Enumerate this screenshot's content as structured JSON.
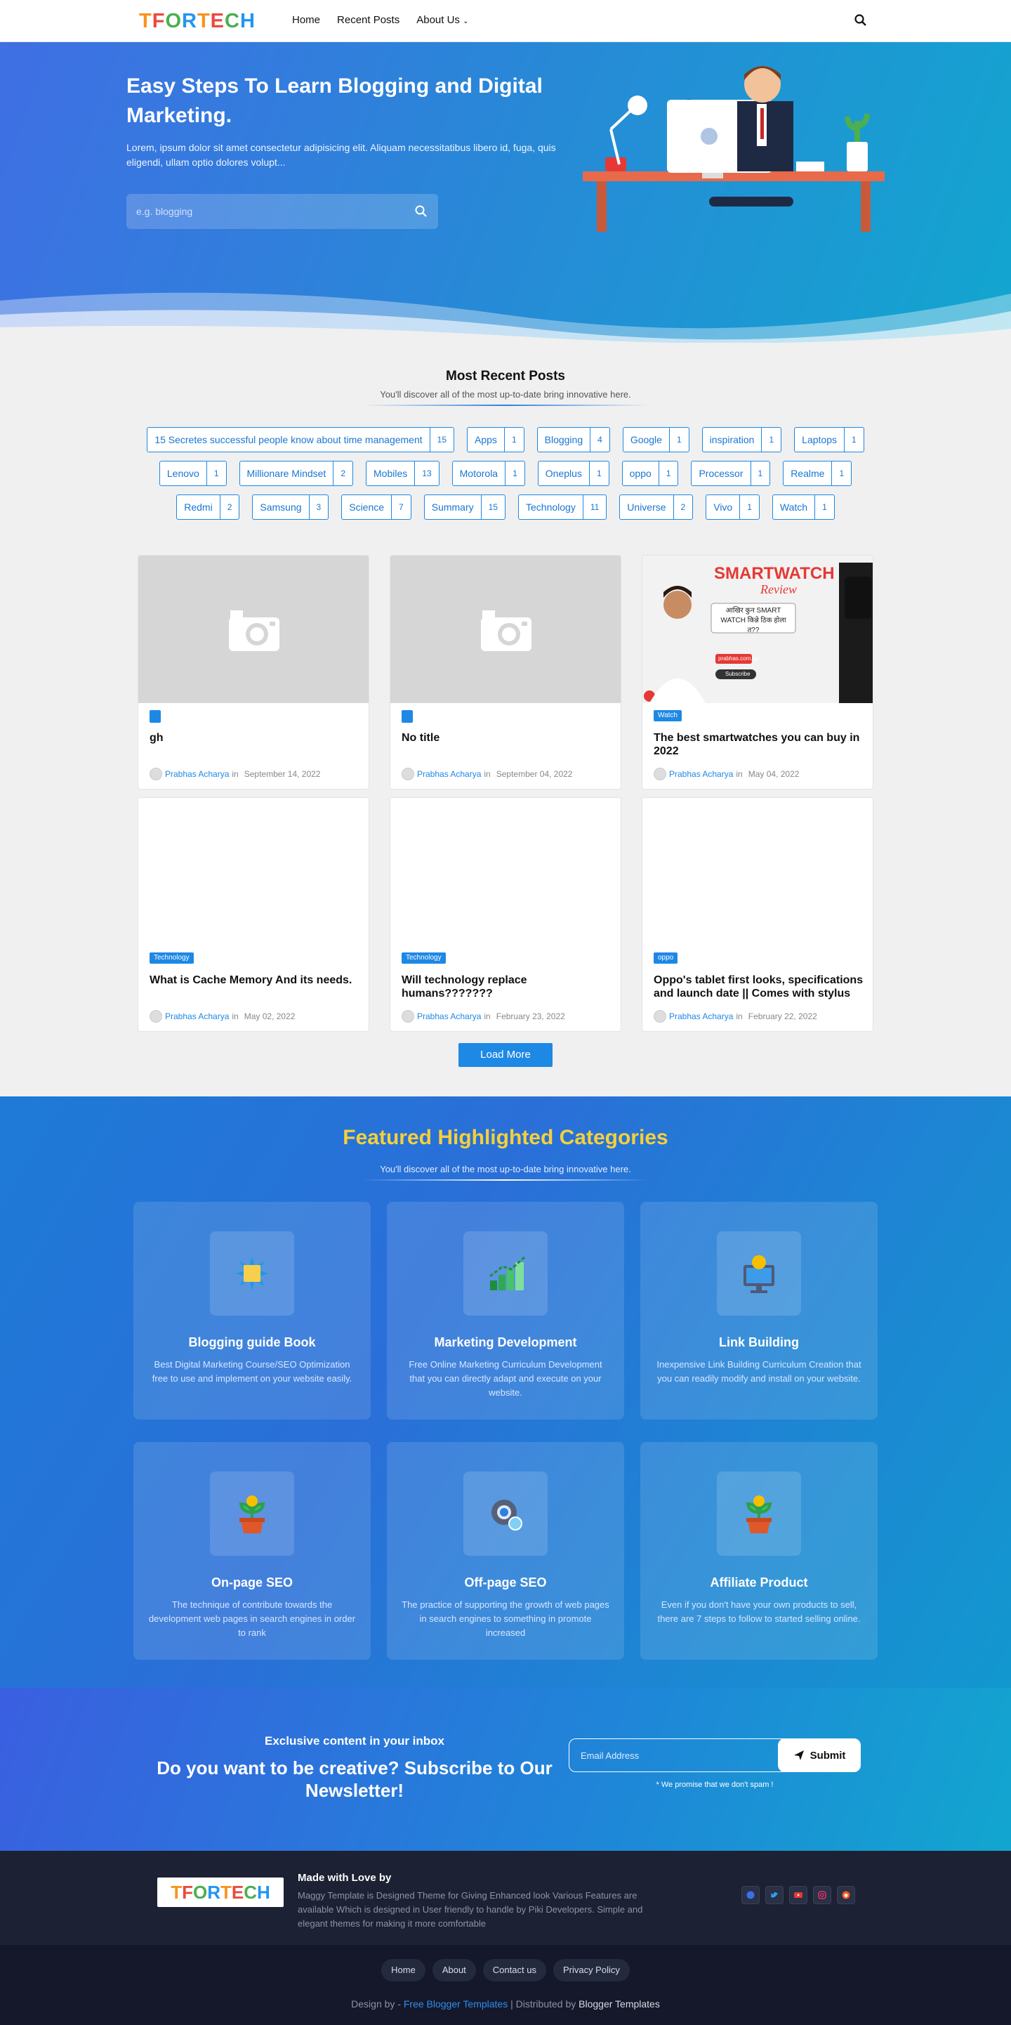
{
  "header": {
    "logo_text": "TFORTECH",
    "nav": [
      "Home",
      "Recent Posts",
      "About Us"
    ]
  },
  "hero": {
    "title": "Easy Steps To Learn Blogging and Digital Marketing.",
    "text": "Lorem, ipsum dolor sit amet consectetur adipisicing elit. Aliquam necessitatibus libero id, fuga, quis eligendi, ullam optio dolores volupt...",
    "search_placeholder": "e.g. blogging"
  },
  "recent": {
    "title": "Most Recent Posts",
    "subtitle": "You'll discover all of the most up-to-date bring innovative here.",
    "tags": [
      {
        "name": "15 Secretes successful people know about time management",
        "count": "15"
      },
      {
        "name": "Apps",
        "count": "1"
      },
      {
        "name": "Blogging",
        "count": "4"
      },
      {
        "name": "Google",
        "count": "1"
      },
      {
        "name": "inspiration",
        "count": "1"
      },
      {
        "name": "Laptops",
        "count": "1"
      },
      {
        "name": "Lenovo",
        "count": "1"
      },
      {
        "name": "Millionare Mindset",
        "count": "2"
      },
      {
        "name": "Mobiles",
        "count": "13"
      },
      {
        "name": "Motorola",
        "count": "1"
      },
      {
        "name": "Oneplus",
        "count": "1"
      },
      {
        "name": "oppo",
        "count": "1"
      },
      {
        "name": "Processor",
        "count": "1"
      },
      {
        "name": "Realme",
        "count": "1"
      },
      {
        "name": "Redmi",
        "count": "2"
      },
      {
        "name": "Samsung",
        "count": "3"
      },
      {
        "name": "Science",
        "count": "7"
      },
      {
        "name": "Summary",
        "count": "15"
      },
      {
        "name": "Technology",
        "count": "11"
      },
      {
        "name": "Universe",
        "count": "2"
      },
      {
        "name": "Vivo",
        "count": "1"
      },
      {
        "name": "Watch",
        "count": "1"
      }
    ],
    "posts": [
      {
        "category": "",
        "title": "gh",
        "author": "Prabhas Acharya",
        "in": "in",
        "date": "September 14, 2022",
        "thumb": "placeholder"
      },
      {
        "category": "",
        "title": "No title",
        "author": "Prabhas Acharya",
        "in": "in",
        "date": "September 04, 2022",
        "thumb": "placeholder"
      },
      {
        "category": "Watch",
        "title": "The best smartwatches you can buy in 2022",
        "author": "Prabhas Acharya",
        "in": "in",
        "date": "May 04, 2022",
        "thumb": "smartwatch"
      },
      {
        "category": "Technology",
        "title": "What is Cache Memory And its needs.",
        "author": "Prabhas Acharya",
        "in": "in",
        "date": "May 02, 2022",
        "thumb": "blank"
      },
      {
        "category": "Technology",
        "title": "Will technology replace humans???????",
        "author": "Prabhas Acharya",
        "in": "in",
        "date": "February 23, 2022",
        "thumb": "blank"
      },
      {
        "category": "oppo",
        "title": "Oppo's tablet first looks, specifications and launch date || Comes with stylus",
        "author": "Prabhas Acharya",
        "in": "in",
        "date": "February 22, 2022",
        "thumb": "blank"
      }
    ],
    "smartwatch_thumb": {
      "heading": "SMARTWATCH",
      "sub": "Review",
      "question": "आखिर कुन SMART WATCH किन्ने ठिक होला त??",
      "site": "prabhas.com.np",
      "subscribe": "Subscribe"
    },
    "load_more": "Load More"
  },
  "featured": {
    "title": "Featured Highlighted Categories",
    "subtitle": "You'll discover all of the most up-to-date bring innovative here.",
    "items": [
      {
        "title": "Blogging guide Book",
        "text": "Best Digital Marketing Course/SEO Optimization free to use and implement on your website easily.",
        "icon": "book-icon"
      },
      {
        "title": "Marketing Development",
        "text": "Free Online Marketing Curriculum Development that you can directly adapt and execute on your website.",
        "icon": "chart-icon"
      },
      {
        "title": "Link Building",
        "text": "Inexpensive Link Building Curriculum Creation that you can readily modify and install on your website.",
        "icon": "monitor-coin-icon"
      },
      {
        "title": "On-page SEO",
        "text": "The technique of contribute towards the development web pages in search engines in order to rank",
        "icon": "plant-coin-icon"
      },
      {
        "title": "Off-page SEO",
        "text": "The practice of supporting the growth of web pages in search engines to something in promote increased",
        "icon": "gear-search-icon"
      },
      {
        "title": "Affiliate Product",
        "text": "Even if you don't have your own products to sell, there are 7 steps to follow to started selling online.",
        "icon": "plant-coin-icon"
      }
    ]
  },
  "newsletter": {
    "small": "Exclusive content in your inbox",
    "big": "Do you want to be creative? Subscribe to Our Newsletter!",
    "placeholder": "Email Address",
    "submit": "Submit",
    "promise": "* We promise that we don't spam !"
  },
  "footer": {
    "heading": "Made with Love by",
    "desc": "Maggy Template is Designed Theme for Giving Enhanced look Various Features are available Which is designed in User friendly to handle by Piki Developers. Simple and elegant themes for making it more comfortable",
    "social": [
      "facebook-icon",
      "twitter-icon",
      "youtube-icon",
      "instagram-icon",
      "reddit-icon"
    ],
    "links": [
      "Home",
      "About",
      "Contact us",
      "Privacy Policy"
    ],
    "credit_pre": "Design by - ",
    "credit_link": "Free Blogger Templates",
    "credit_mid": " | Distributed by ",
    "credit_end": "Blogger Templates"
  },
  "colors": {
    "accent": "#1e88e5",
    "featured_title": "#f5d03b",
    "footer_bg": "#1c2133"
  }
}
